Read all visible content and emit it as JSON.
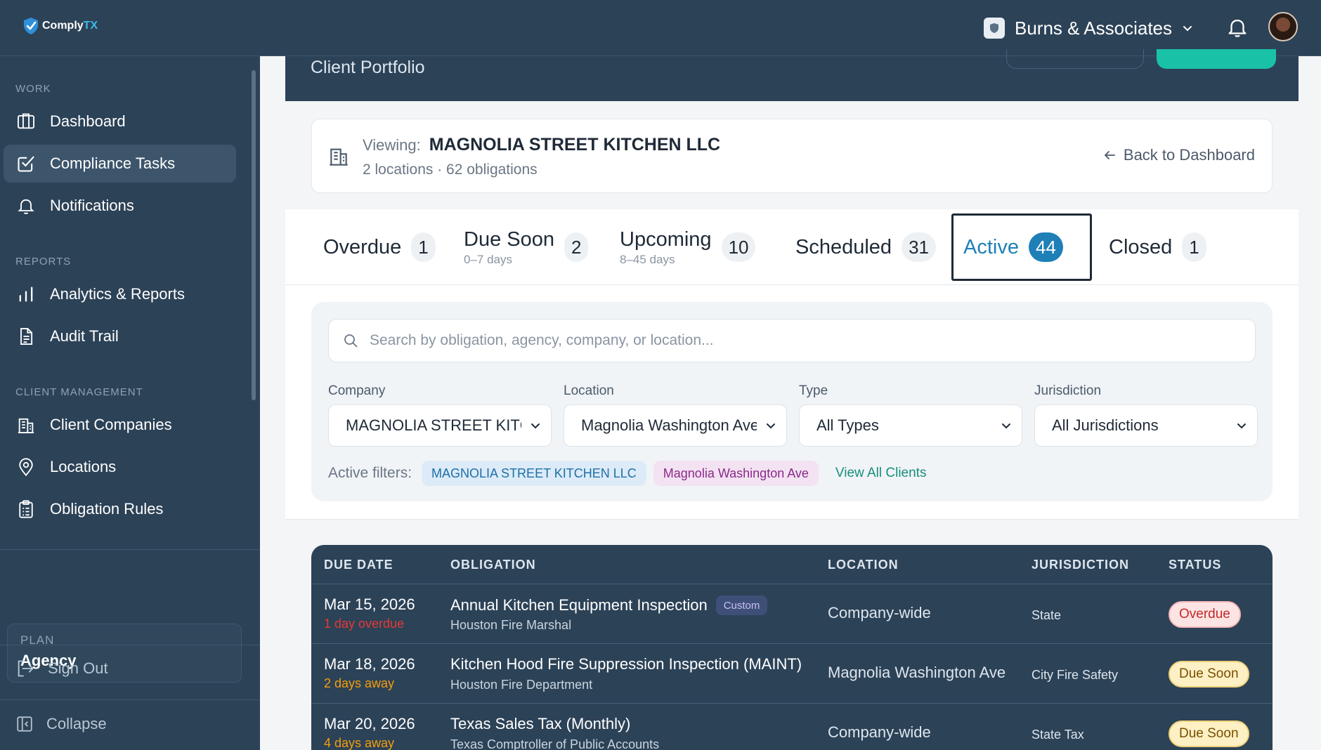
{
  "app": {
    "logo_main": "Comply",
    "logo_accent": "TX"
  },
  "header": {
    "org_name": "Burns & Associates"
  },
  "sidebar": {
    "sections": {
      "work": "WORK",
      "reports": "REPORTS",
      "client_management": "CLIENT MANAGEMENT"
    },
    "items": [
      {
        "label": "Dashboard",
        "icon": "columns-icon"
      },
      {
        "label": "Compliance Tasks",
        "icon": "checkbox-icon",
        "active": true
      },
      {
        "label": "Notifications",
        "icon": "bell-icon"
      },
      {
        "label": "Analytics & Reports",
        "icon": "bar-chart-icon"
      },
      {
        "label": "Audit Trail",
        "icon": "document-icon"
      },
      {
        "label": "Client Companies",
        "icon": "building-icon"
      },
      {
        "label": "Locations",
        "icon": "map-pin-icon"
      },
      {
        "label": "Obligation Rules",
        "icon": "clipboard-icon"
      }
    ],
    "plan": {
      "label": "PLAN",
      "value": "Agency"
    },
    "sign_out": "Sign Out",
    "collapse": "Collapse"
  },
  "hero": {
    "title": "Client Portfolio"
  },
  "viewing": {
    "label": "Viewing:",
    "name": "MAGNOLIA STREET KITCHEN LLC",
    "summary": "2 locations · 62 obligations",
    "back_label": "Back to Dashboard"
  },
  "tabs": [
    {
      "label": "Overdue",
      "sub": "",
      "count": "1"
    },
    {
      "label": "Due Soon",
      "sub": "0–7 days",
      "count": "2"
    },
    {
      "label": "Upcoming",
      "sub": "8–45 days",
      "count": "10"
    },
    {
      "label": "Scheduled",
      "sub": "",
      "count": "31"
    },
    {
      "label": "Active",
      "sub": "",
      "count": "44",
      "active": true
    },
    {
      "label": "Closed",
      "sub": "",
      "count": "1"
    }
  ],
  "filters": {
    "search_placeholder": "Search by obligation, agency, company, or location...",
    "company": {
      "label": "Company",
      "value": "MAGNOLIA STREET KITCHEN LLC"
    },
    "location": {
      "label": "Location",
      "value": "Magnolia Washington Ave"
    },
    "type": {
      "label": "Type",
      "value": "All Types"
    },
    "jurisdiction": {
      "label": "Jurisdiction",
      "value": "All Jurisdictions"
    },
    "active_label": "Active filters:",
    "chips": [
      "MAGNOLIA STREET KITCHEN LLC",
      "Magnolia Washington Ave"
    ],
    "view_all": "View All Clients"
  },
  "table": {
    "headers": {
      "due_date": "DUE DATE",
      "obligation": "OBLIGATION",
      "location": "LOCATION",
      "jurisdiction": "JURISDICTION",
      "status": "STATUS"
    },
    "rows": [
      {
        "date": "Mar 15, 2026",
        "relative": "1 day overdue",
        "relative_color": "#e53935",
        "obligation": "Annual Kitchen Equipment Inspection",
        "tag": "Custom",
        "agency": "Houston Fire Marshal",
        "location": "Company-wide",
        "jurisdiction": "State",
        "status": "Overdue"
      },
      {
        "date": "Mar 18, 2026",
        "relative": "2 days away",
        "relative_color": "#f59e0b",
        "obligation": "Kitchen Hood Fire Suppression Inspection (MAINT)",
        "tag": "",
        "agency": "Houston Fire Department",
        "location": "Magnolia Washington Ave",
        "jurisdiction": "City Fire Safety",
        "status": "Due Soon"
      },
      {
        "date": "Mar 20, 2026",
        "relative": "4 days away",
        "relative_color": "#f59e0b",
        "obligation": "Texas Sales Tax (Monthly)",
        "tag": "",
        "agency": "Texas Comptroller of Public Accounts",
        "location": "Company-wide",
        "jurisdiction": "State Tax",
        "status": "Due Soon"
      }
    ]
  }
}
